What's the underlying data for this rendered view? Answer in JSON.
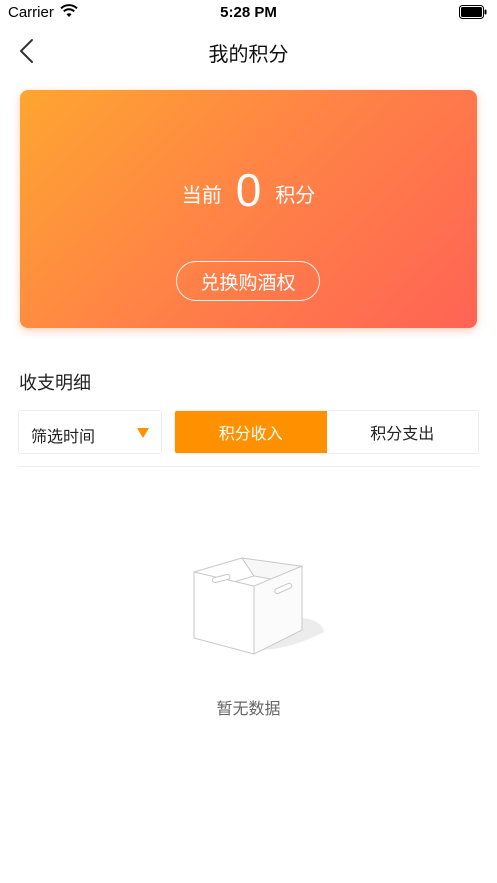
{
  "status_bar": {
    "carrier": "Carrier",
    "time": "5:28 PM",
    "icons": [
      "wifi-icon",
      "battery-icon"
    ]
  },
  "nav": {
    "title": "我的积分",
    "back_icon": "chevron-left-icon"
  },
  "points_card": {
    "prefix": "当前",
    "value": "0",
    "suffix": "积分",
    "exchange_button": "兑换购酒权",
    "gradient_colors": [
      "#fea530",
      "#ff6355"
    ]
  },
  "details": {
    "section_title": "收支明细",
    "filter": {
      "label": "筛选时间",
      "icon": "caret-down-icon"
    },
    "tabs": [
      {
        "label": "积分收入",
        "active": true
      },
      {
        "label": "积分支出",
        "active": false
      }
    ],
    "accent_color": "#ff9100"
  },
  "empty_state": {
    "icon": "empty-box-icon",
    "text": "暂无数据"
  }
}
